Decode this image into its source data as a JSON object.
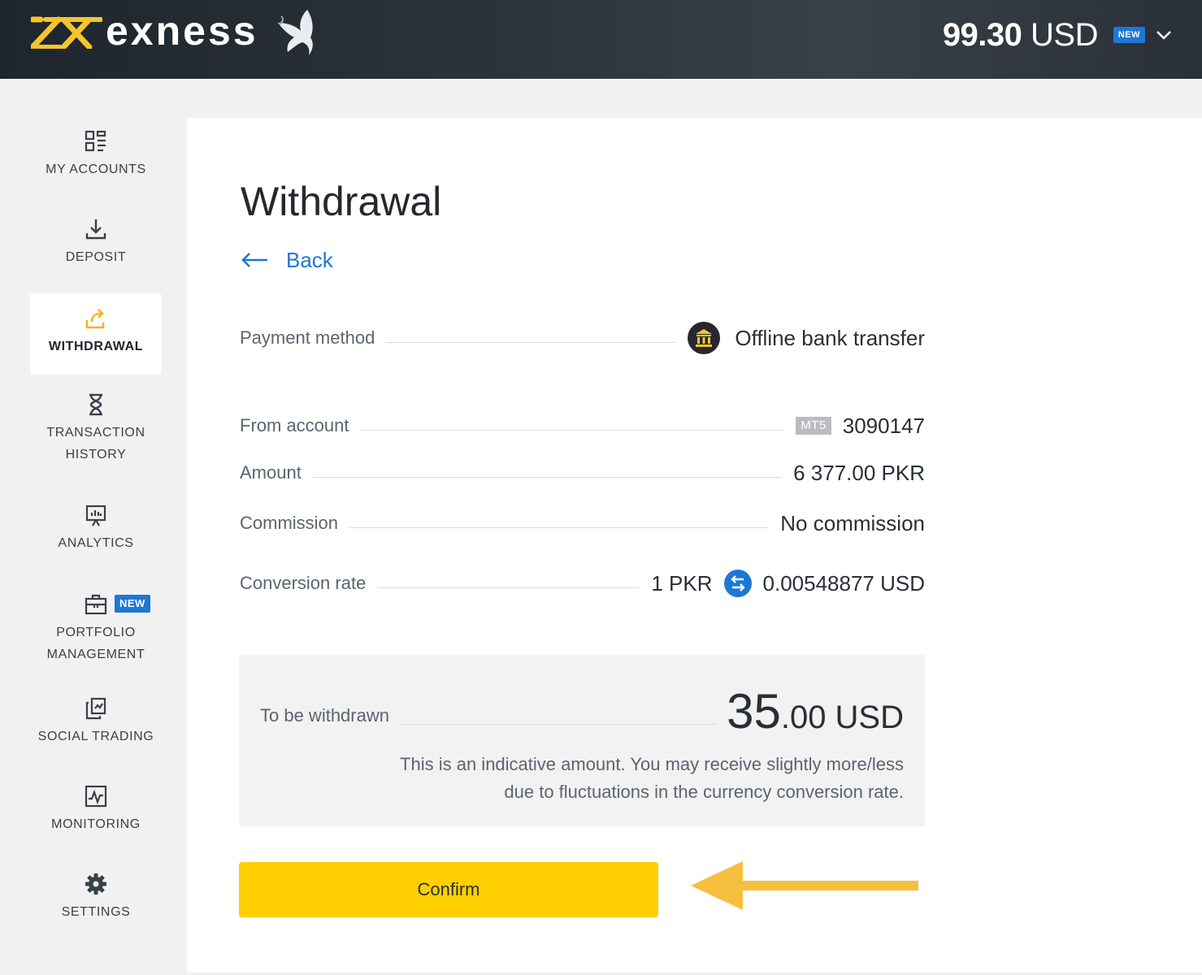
{
  "header": {
    "brand": "exness",
    "balance_amount": "99.30",
    "balance_currency": " USD",
    "new_badge": "NEW"
  },
  "sidebar": {
    "items": [
      {
        "label": "MY ACCOUNTS",
        "icon": "grid-icon"
      },
      {
        "label": "DEPOSIT",
        "icon": "download-icon"
      },
      {
        "label": "WITHDRAWAL",
        "icon": "upload-share-icon",
        "active": true
      },
      {
        "label": "TRANSACTION HISTORY",
        "icon": "hourglass-icon"
      },
      {
        "label": "ANALYTICS",
        "icon": "presentation-chart-icon"
      },
      {
        "label": "PORTFOLIO MANAGEMENT",
        "icon": "briefcase-icon",
        "badge": "NEW"
      },
      {
        "label": "SOCIAL TRADING",
        "icon": "copy-icon"
      },
      {
        "label": "MONITORING",
        "icon": "pulse-chart-icon"
      },
      {
        "label": "SETTINGS",
        "icon": "gear-icon"
      }
    ]
  },
  "main": {
    "title": "Withdrawal",
    "back_label": "Back",
    "rows": {
      "payment_method": {
        "label": "Payment method",
        "value": "Offline bank transfer"
      },
      "from_account": {
        "label": "From account",
        "badge": "MT5",
        "value": "3090147"
      },
      "amount": {
        "label": "Amount",
        "value": "6 377.00 PKR"
      },
      "commission": {
        "label": "Commission",
        "value": "No commission"
      },
      "conversion_rate": {
        "label": "Conversion rate",
        "from": "1 PKR",
        "to": "0.00548877 USD"
      }
    },
    "summary": {
      "label": "To be withdrawn",
      "amount_whole": "35",
      "amount_fraction": ".00 USD",
      "note_line1": "This is an indicative amount. You may receive slightly more/less",
      "note_line2": "due to fluctuations in the currency conversion rate."
    },
    "confirm_label": "Confirm"
  },
  "colors": {
    "accent_yellow": "#ffcf01",
    "link_blue": "#1d77d6",
    "header_dark": "#2b323a",
    "arrow_orange": "#f7bf3e",
    "nav_active_icon": "#f2b51d"
  }
}
